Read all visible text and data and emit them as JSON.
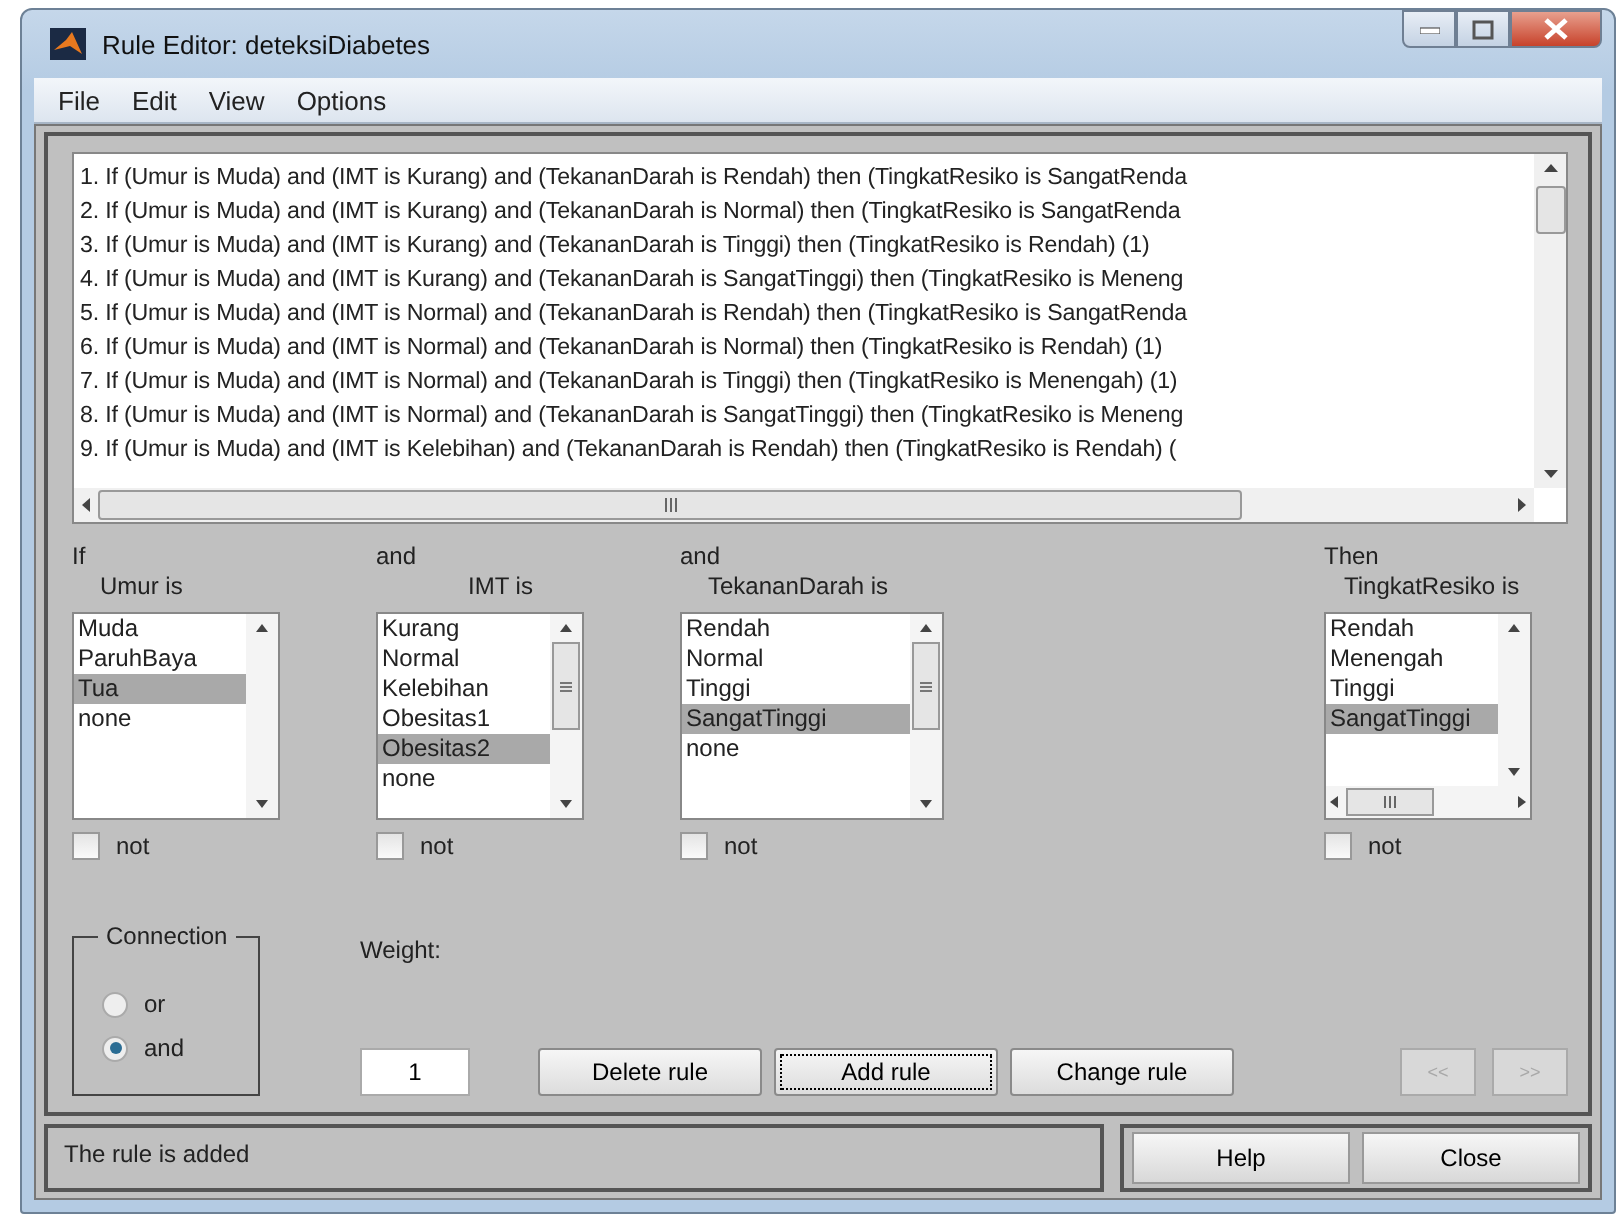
{
  "window": {
    "title": "Rule Editor: deteksiDiabetes"
  },
  "menu": [
    "File",
    "Edit",
    "View",
    "Options"
  ],
  "rules": [
    "1. If (Umur is Muda) and (IMT is Kurang) and (TekananDarah is Rendah) then (TingkatResiko is SangatRenda",
    "2. If (Umur is Muda) and (IMT is Kurang) and (TekananDarah is Normal) then (TingkatResiko is SangatRenda",
    "3. If (Umur is Muda) and (IMT is Kurang) and (TekananDarah is Tinggi) then (TingkatResiko is Rendah) (1)",
    "4. If (Umur is Muda) and (IMT is Kurang) and (TekananDarah is SangatTinggi) then (TingkatResiko is Meneng",
    "5. If (Umur is Muda) and (IMT is Normal) and (TekananDarah is Rendah) then (TingkatResiko is SangatRenda",
    "6. If (Umur is Muda) and (IMT is Normal) and (TekananDarah is Normal) then (TingkatResiko is Rendah) (1)",
    "7. If (Umur is Muda) and (IMT is Normal) and (TekananDarah is Tinggi) then (TingkatResiko is Menengah) (1)",
    "8. If (Umur is Muda) and (IMT is Normal) and (TekananDarah is SangatTinggi) then (TingkatResiko is Meneng",
    "9. If (Umur is Muda) and (IMT is Kelebihan) and (TekananDarah is Rendah) then (TingkatResiko is Rendah) ("
  ],
  "variables": [
    {
      "connector": "If",
      "label": "Umur is",
      "not_label": "not",
      "not_checked": false,
      "items": [
        {
          "text": "Muda",
          "selected": false
        },
        {
          "text": "ParuhBaya",
          "selected": false
        },
        {
          "text": "Tua",
          "selected": true
        },
        {
          "text": "none",
          "selected": false
        }
      ]
    },
    {
      "connector": "and",
      "label": "IMT is",
      "not_label": "not",
      "not_checked": false,
      "items": [
        {
          "text": "Kurang",
          "selected": false
        },
        {
          "text": "Normal",
          "selected": false
        },
        {
          "text": "Kelebihan",
          "selected": false
        },
        {
          "text": "Obesitas1",
          "selected": false
        },
        {
          "text": "Obesitas2",
          "selected": true
        },
        {
          "text": "none",
          "selected": false
        }
      ]
    },
    {
      "connector": "and",
      "label": "TekananDarah is",
      "not_label": "not",
      "not_checked": false,
      "items": [
        {
          "text": "Rendah",
          "selected": false
        },
        {
          "text": "Normal",
          "selected": false
        },
        {
          "text": "Tinggi",
          "selected": false
        },
        {
          "text": "SangatTinggi",
          "selected": true
        },
        {
          "text": "none",
          "selected": false
        }
      ]
    },
    {
      "connector": "Then",
      "label": "TingkatResiko is",
      "not_label": "not",
      "not_checked": false,
      "items": [
        {
          "text": "Rendah",
          "selected": false
        },
        {
          "text": "Menengah",
          "selected": false
        },
        {
          "text": "Tinggi",
          "selected": false
        },
        {
          "text": "SangatTinggi",
          "selected": true
        }
      ]
    }
  ],
  "connection": {
    "title": "Connection",
    "options": [
      {
        "label": "or",
        "selected": false
      },
      {
        "label": "and",
        "selected": true
      }
    ]
  },
  "weight": {
    "label": "Weight:",
    "value": "1"
  },
  "buttons": [
    {
      "label": "Delete rule",
      "focused": false
    },
    {
      "label": "Add rule",
      "focused": true
    },
    {
      "label": "Change rule",
      "focused": false
    }
  ],
  "nav": [
    {
      "label": "<<",
      "disabled": true
    },
    {
      "label": ">>",
      "disabled": true
    }
  ],
  "status": "The rule is added",
  "footer_buttons": [
    "Help",
    "Close"
  ]
}
